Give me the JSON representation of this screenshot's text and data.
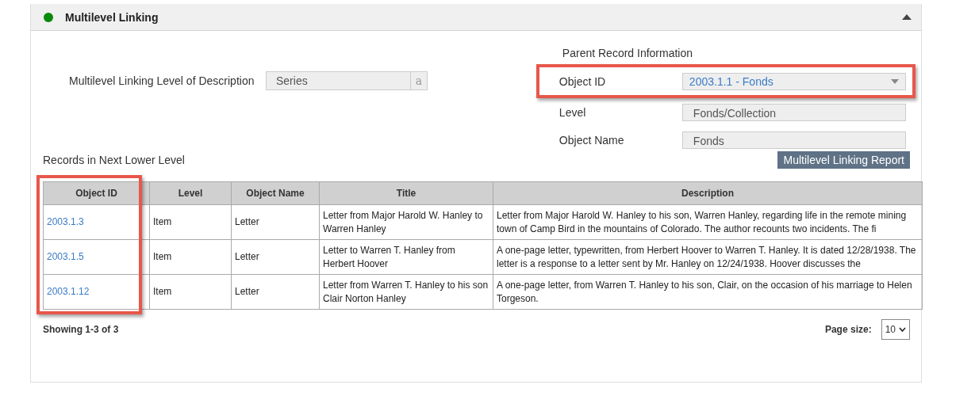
{
  "panel": {
    "title": "Multilevel Linking",
    "expanded": true
  },
  "level_of_description": {
    "label": "Multilevel Linking Level of Description",
    "value": "Series",
    "button": "a"
  },
  "parent_record": {
    "heading": "Parent Record Information",
    "fields": [
      {
        "label": "Object ID",
        "value": "2003.1.1 - Fonds",
        "kind": "select",
        "highlighted": true
      },
      {
        "label": "Level",
        "value": "Fonds/Collection",
        "kind": "text",
        "highlighted": false
      },
      {
        "label": "Object Name",
        "value": "Fonds",
        "kind": "text",
        "highlighted": false
      }
    ]
  },
  "report_button": "Multilevel Linking Report",
  "records": {
    "heading": "Records in Next Lower Level",
    "columns": [
      {
        "label": "Object ID",
        "kind": "link",
        "highlighted": true
      },
      {
        "label": "Level",
        "kind": "text",
        "highlighted": false
      },
      {
        "label": "Object Name",
        "kind": "text",
        "highlighted": false
      },
      {
        "label": "Title",
        "kind": "text",
        "highlighted": false
      },
      {
        "label": "Description",
        "kind": "text",
        "highlighted": false
      }
    ],
    "rows": [
      [
        "2003.1.3",
        "Item",
        "Letter",
        "Letter from Major Harold W. Hanley to Warren Hanley",
        "Letter from Major Harold W. Hanley to his son, Warren Hanley, regarding life in the  remote mining town of Camp Bird in the mountains of Colorado.  The author recounts two incidents.  The fi"
      ],
      [
        "2003.1.5",
        "Item",
        "Letter",
        "Letter to Warren T. Hanley from Herbert Hoover",
        "A one-page letter, typewritten, from Herbert Hoover to Warren T. Hanley. It is dated 12/28/1938. The letter is a response to a letter sent by Mr. Hanley on 12/24/1938. Hoover discusses the"
      ],
      [
        "2003.1.12",
        "Item",
        "Letter",
        "Letter from Warren T. Hanley to his son Clair Norton Hanley",
        "A one-page letter, from Warren T. Hanley to his son, Clair, on the occasion of his marriage to Helen Torgeson."
      ]
    ]
  },
  "footer": {
    "showing": "Showing 1-3 of 3",
    "page_size_label": "Page size:",
    "page_size": "10"
  }
}
